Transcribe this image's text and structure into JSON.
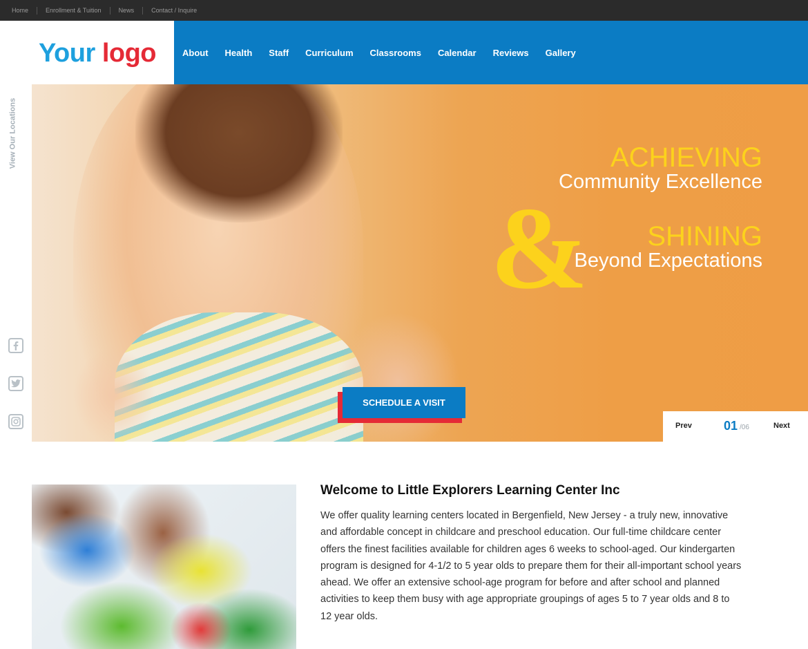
{
  "topbar": {
    "links": [
      "Home",
      "Enrollment & Tuition",
      "News",
      "Contact / Inquire"
    ]
  },
  "logo": {
    "part1": "Your",
    "part2": "logo"
  },
  "nav": {
    "items": [
      "About",
      "Health",
      "Staff",
      "Curriculum",
      "Classrooms",
      "Calendar",
      "Reviews",
      "Gallery"
    ]
  },
  "sidebar": {
    "locations_label": "View Our Locations",
    "social": [
      "facebook-icon",
      "twitter-icon",
      "instagram-icon"
    ]
  },
  "hero": {
    "line1": "ACHIEVING",
    "line2": "Community Excellence",
    "ampersand": "&",
    "line3": "SHINING",
    "line4": "Beyond Expectations",
    "cta_label": "SCHEDULE A VISIT",
    "pager": {
      "prev": "Prev",
      "current": "01",
      "total": "/06",
      "next": "Next"
    }
  },
  "welcome": {
    "title": "Welcome to Little Explorers Learning Center Inc",
    "body": "We offer quality learning centers located in Bergenfield, New Jersey - a truly new, innovative and affordable concept in childcare and preschool education. Our full-time childcare center offers the finest facilities available for children ages 6 weeks to school-aged. Our kindergarten program is designed for 4-1/2 to 5 year olds to prepare them for their all-important school years ahead. We offer an extensive school-age program for before and after school and planned activities to keep them busy with age appropriate groupings of ages 5 to 7 year olds and 8 to 12 year olds."
  },
  "colors": {
    "nav_blue": "#0b7cc4",
    "logo_blue": "#1ea0de",
    "logo_red": "#e52a36",
    "hero_yellow": "#fcd21c",
    "hero_orange": "#ef9d45",
    "topbar_bg": "#2b2b2b"
  }
}
